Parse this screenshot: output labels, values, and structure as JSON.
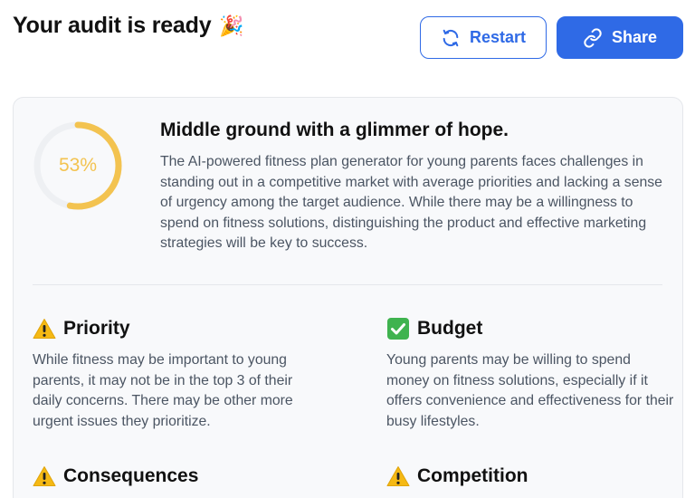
{
  "header": {
    "title": "Your audit is ready",
    "title_emoji": "🎉",
    "restart_label": "Restart",
    "share_label": "Share"
  },
  "colors": {
    "primary": "#2f6ae6",
    "score_ring": "#f3c350",
    "card_bg": "#f8f9fb"
  },
  "score": {
    "percent": 53,
    "label": "53%"
  },
  "summary": {
    "title": "Middle ground with a glimmer of hope.",
    "body": "The AI-powered fitness plan generator for young parents faces challenges in standing out in a competitive market with average priorities and lacking a sense of urgency among the target audience. While there may be a willingness to spend on fitness solutions, distinguishing the product and effective marketing strategies will be key to success."
  },
  "sections": {
    "priority": {
      "icon": "warning-icon",
      "title": "Priority",
      "body": "While fitness may be important to young parents, it may not be in the top 3 of their daily concerns. There may be other more urgent issues they prioritize."
    },
    "budget": {
      "icon": "check-icon",
      "title": "Budget",
      "body": "Young parents may be willing to spend money on fitness solutions, especially if it offers convenience and effectiveness for their busy lifestyles."
    },
    "consequences": {
      "icon": "warning-icon",
      "title": "Consequences",
      "body": ""
    },
    "competition": {
      "icon": "warning-icon",
      "title": "Competition",
      "body": ""
    }
  }
}
